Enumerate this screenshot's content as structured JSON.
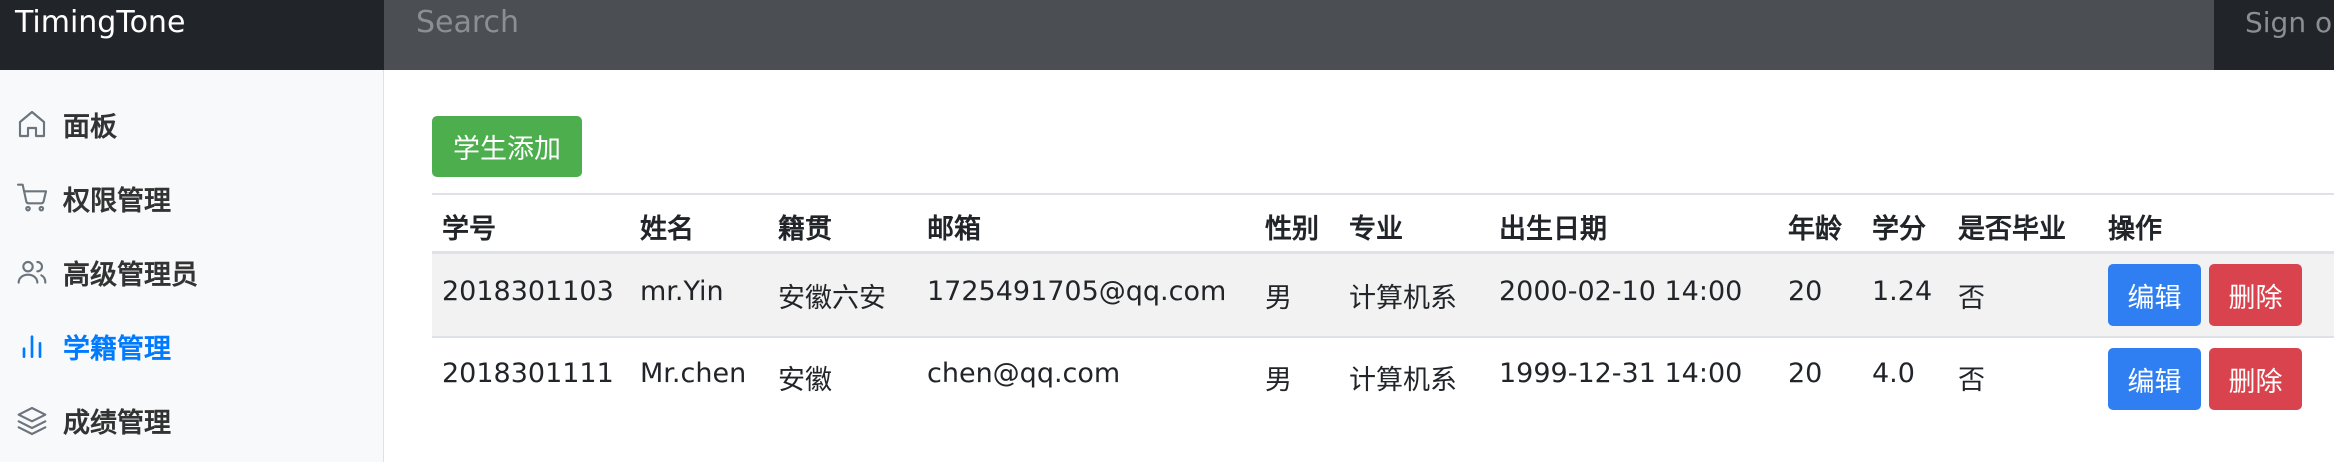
{
  "navbar": {
    "brand": "TimingTone",
    "search_placeholder": "Search",
    "signout_label": "Sign out"
  },
  "sidebar": {
    "items": [
      {
        "label": "面板",
        "icon": "home-icon",
        "active": false
      },
      {
        "label": "权限管理",
        "icon": "shopping-cart-icon",
        "active": false
      },
      {
        "label": "高级管理员",
        "icon": "users-icon",
        "active": false
      },
      {
        "label": "学籍管理",
        "icon": "bar-chart-icon",
        "active": true
      },
      {
        "label": "成绩管理",
        "icon": "layers-icon",
        "active": false
      }
    ]
  },
  "main": {
    "add_button_label": "学生添加",
    "table": {
      "headers": [
        "学号",
        "姓名",
        "籍贯",
        "邮箱",
        "性别",
        "专业",
        "出生日期",
        "年龄",
        "学分",
        "是否毕业",
        "操作"
      ],
      "rows": [
        {
          "cells": [
            "2018301103",
            "mr.Yin",
            "安徽六安",
            "1725491705@qq.com",
            "男",
            "计算机系",
            "2000-02-10 14:00",
            "20",
            "1.24",
            "否"
          ],
          "edit_label": "编辑",
          "delete_label": "删除"
        },
        {
          "cells": [
            "2018301111",
            "Mr.chen",
            "安徽",
            "chen@qq.com",
            "男",
            "计算机系",
            "1999-12-31 14:00",
            "20",
            "4.0",
            "否"
          ],
          "edit_label": "编辑",
          "delete_label": "删除"
        }
      ]
    }
  },
  "colors": {
    "navbar_bg": "#4b4e53",
    "brand_bg": "#212529",
    "active_nav": "#007bff",
    "add_button": "#4cae4c",
    "edit_button": "#2f7ff2",
    "delete_button": "#d9434e"
  }
}
